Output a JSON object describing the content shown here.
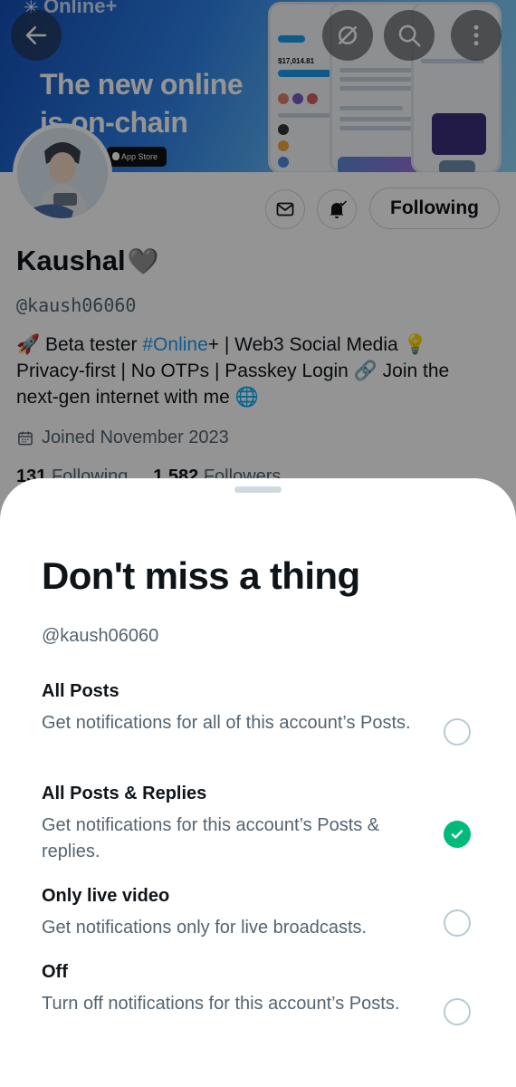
{
  "banner": {
    "brand": "Online+",
    "headline_line1": "The new online",
    "headline_line2": "is on-chain",
    "appstore_label": "App Store",
    "mock_value": "$17,014.81"
  },
  "header_icons": [
    "back-arrow-icon",
    "no-sync-icon",
    "search-icon",
    "more-vertical-icon"
  ],
  "profile": {
    "display_name": "Kaushal",
    "name_emoji": "🩶",
    "handle": "@kaush06060",
    "bio": {
      "prefix": "🚀 Beta tester ",
      "hashtag": "#Online",
      "suffix": "+ | Web3 Social Media 💡 Privacy-first | No OTPs | Passkey Login 🔗 Join the next-gen internet with me 🌐"
    },
    "joined": "Joined November 2023",
    "following_count": "131",
    "following_label": "Following",
    "followers_count": "1,582",
    "followers_label": "Followers",
    "following_button": "Following"
  },
  "sheet": {
    "title": "Don't miss a thing",
    "handle": "@kaush06060",
    "options": [
      {
        "title": "All Posts",
        "desc": "Get notifications for all of this account’s Posts.",
        "selected": false
      },
      {
        "title": "All Posts & Replies",
        "desc": "Get notifications for this account’s Posts & replies.",
        "selected": true
      },
      {
        "title": "Only live video",
        "desc": "Get notifications only for live broadcasts.",
        "selected": false
      },
      {
        "title": "Off",
        "desc": "Turn off notifications for this account’s Posts.",
        "selected": false
      }
    ]
  },
  "colors": {
    "accent_blue": "#1d9bf0",
    "selected_green": "#00ba7c",
    "secondary_text": "#536471",
    "primary_text": "#0f1419"
  }
}
